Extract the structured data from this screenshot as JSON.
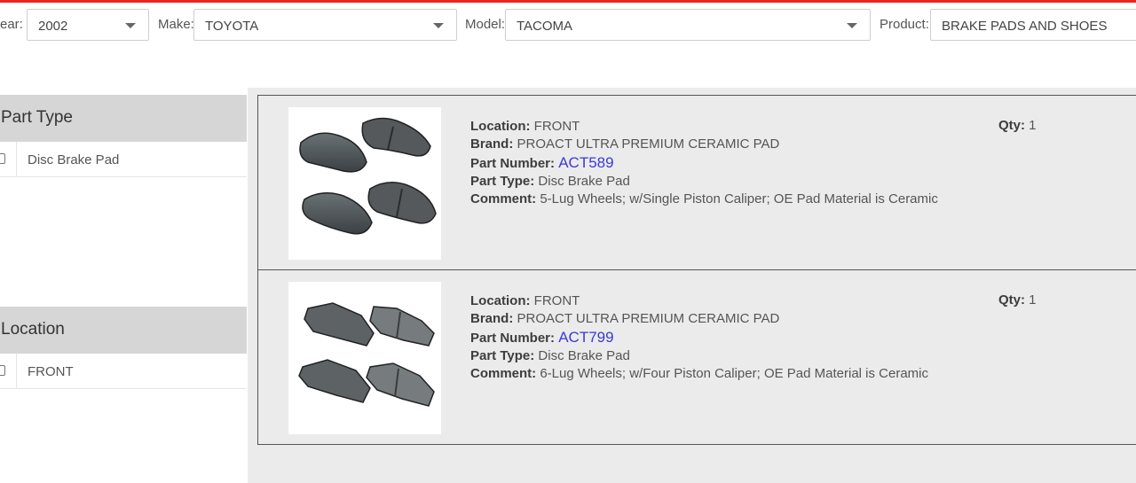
{
  "filters": {
    "year": {
      "label": "ear:",
      "value": "2002"
    },
    "make": {
      "label": "Make:",
      "value": "TOYOTA"
    },
    "model": {
      "label": "Model:",
      "value": "TACOMA"
    },
    "product": {
      "label": "Product:",
      "value": "BRAKE PADS AND  SHOES"
    }
  },
  "sidebar": {
    "facets": [
      {
        "title": "Part Type",
        "options": [
          "Disc Brake Pad"
        ]
      },
      {
        "title": "Location",
        "options": [
          "FRONT"
        ]
      }
    ]
  },
  "labels": {
    "location": "Location:",
    "brand": "Brand:",
    "part_number": "Part Number:",
    "part_type": "Part Type:",
    "comment": "Comment:",
    "qty": "Qty:"
  },
  "results": [
    {
      "location": "FRONT",
      "brand": "PROACT ULTRA PREMIUM CERAMIC PAD",
      "part_number": "ACT589",
      "part_type": "Disc Brake Pad",
      "comment": "5-Lug Wheels; w/Single Piston Caliper; OE Pad Material is Ceramic",
      "qty": "1"
    },
    {
      "location": "FRONT",
      "brand": "PROACT ULTRA PREMIUM CERAMIC PAD",
      "part_number": "ACT799",
      "part_type": "Disc Brake Pad",
      "comment": "6-Lug Wheels; w/Four Piston Caliper; OE Pad Material is Ceramic",
      "qty": "1"
    }
  ],
  "colors": {
    "accent_bar": "#e8261c",
    "link": "#3a3ad6",
    "facet_header": "#d6d6d6",
    "results_bg": "#ebebeb"
  }
}
